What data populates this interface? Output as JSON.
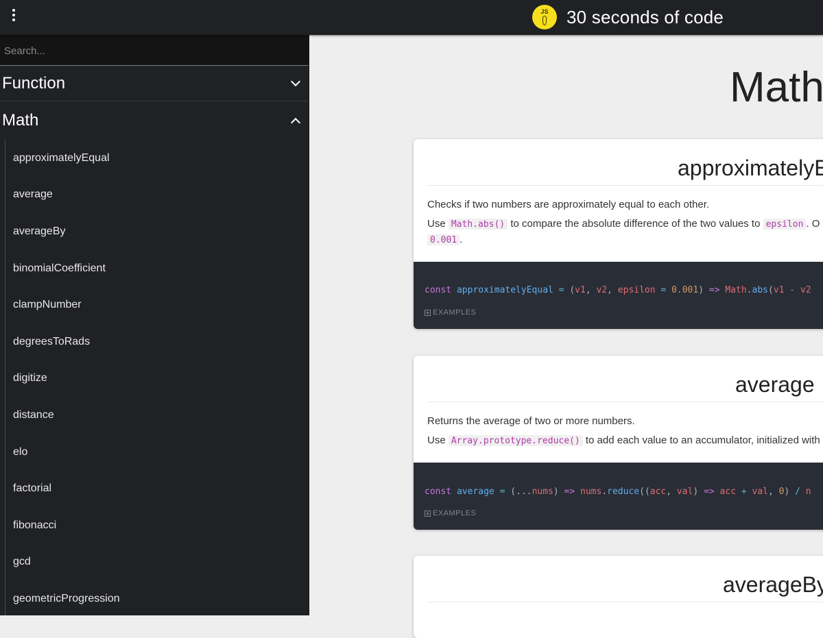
{
  "header": {
    "title": "30 seconds of code",
    "logo_text": "JS",
    "menu_icon": "vertical-dots-icon"
  },
  "sidebar": {
    "search_placeholder": "Search...",
    "categories": [
      {
        "label": "Function",
        "expanded": false
      },
      {
        "label": "Math",
        "expanded": true
      }
    ],
    "items": [
      "approximatelyEqual",
      "average",
      "averageBy",
      "binomialCoefficient",
      "clampNumber",
      "degreesToRads",
      "digitize",
      "distance",
      "elo",
      "factorial",
      "fibonacci",
      "gcd",
      "geometricProgression"
    ]
  },
  "main": {
    "page_title": "Math",
    "cards": [
      {
        "title": "approximatelyE",
        "summary": "Checks if two numbers are approximately equal to each other.",
        "use_prefix": "Use",
        "use_code1": "Math.abs()",
        "use_mid": "to compare the absolute difference of the two values to",
        "use_code2": "epsilon",
        "use_suffix": ". O",
        "use_line2_code": "0.001",
        "use_line2_suffix": ".",
        "examples_label": "EXAMPLES"
      },
      {
        "title": "average",
        "summary": "Returns the average of two or more numbers.",
        "use_prefix": "Use",
        "use_code1": "Array.prototype.reduce()",
        "use_mid": "to add each value to an accumulator, initialized with",
        "examples_label": "EXAMPLES"
      },
      {
        "title": "averageBy"
      }
    ]
  },
  "colors": {
    "header_bg": "#202124",
    "sidebar_bg": "#202124",
    "content_bg": "#eeeeee",
    "code_bg": "#292d35",
    "logo": "#f7df1e"
  }
}
